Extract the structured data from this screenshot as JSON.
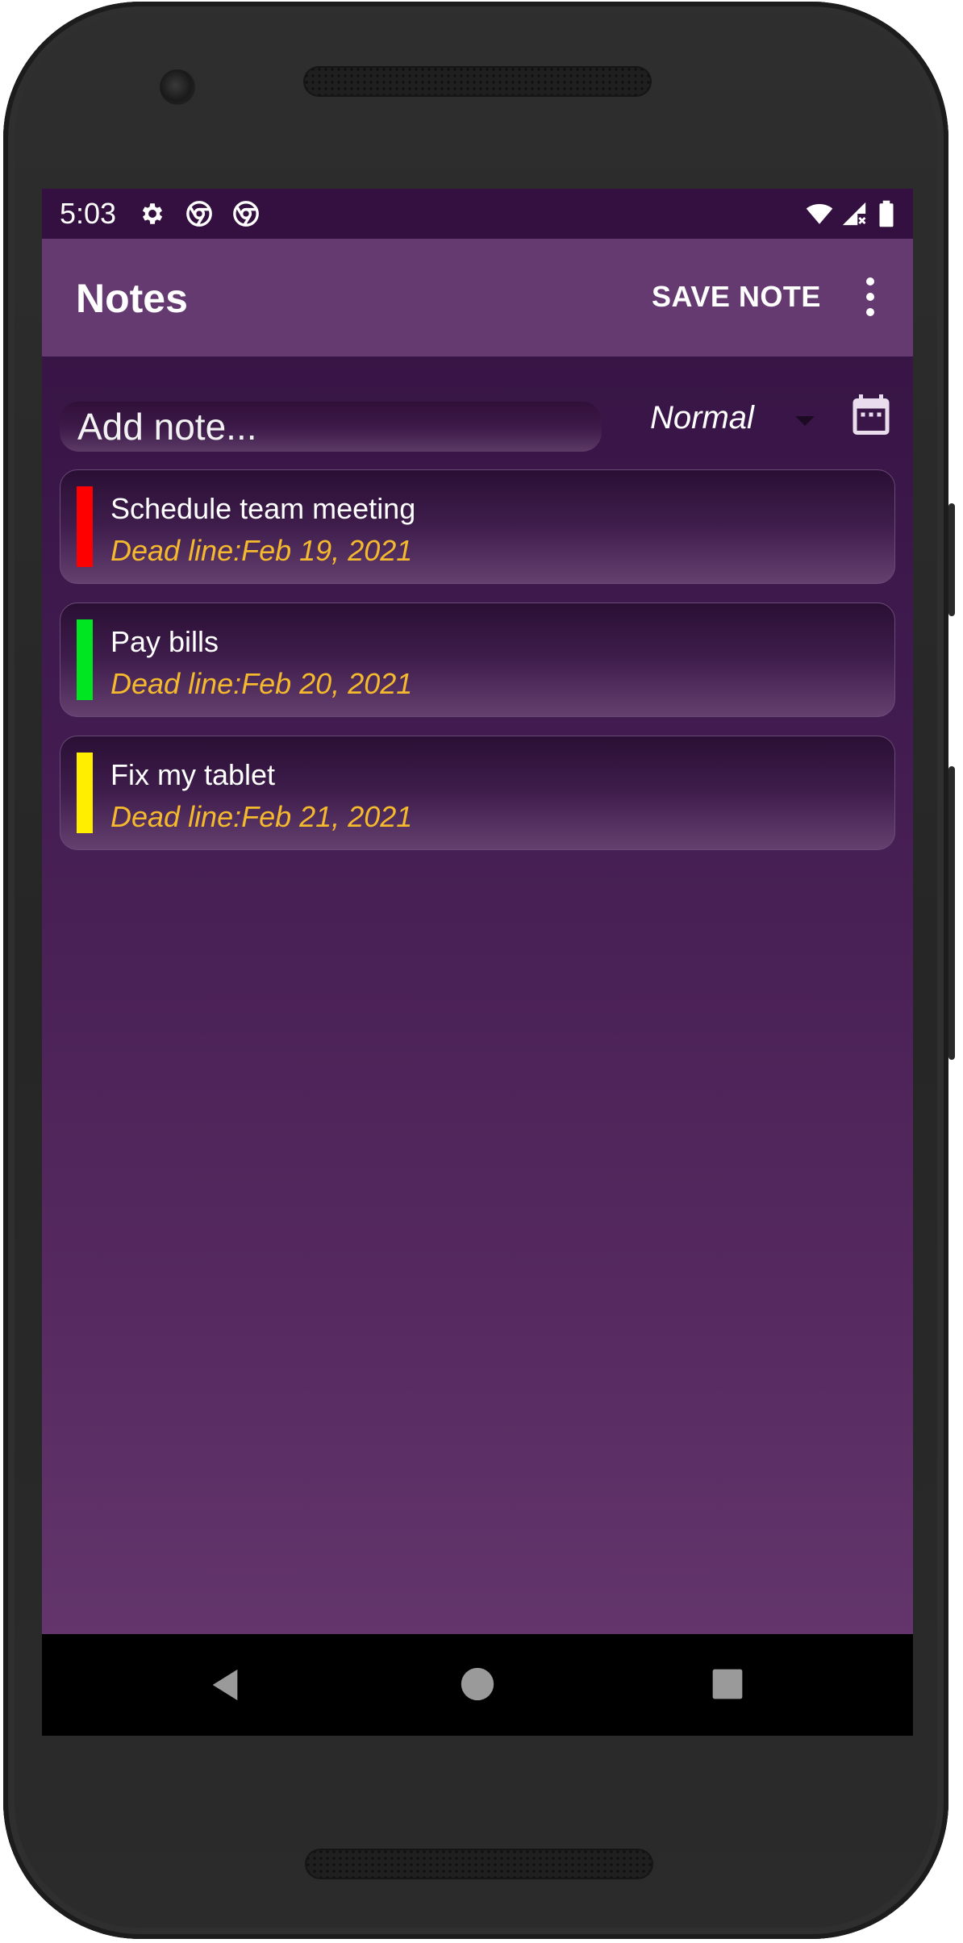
{
  "status_bar": {
    "time": "5:03"
  },
  "app_bar": {
    "title": "Notes",
    "save_label": "SAVE NOTE"
  },
  "composer": {
    "placeholder": "Add note...",
    "priority": "Normal"
  },
  "notes": [
    {
      "title": "Schedule team meeting",
      "deadline": "Dead line:Feb 19, 2021",
      "color": "#ff0000"
    },
    {
      "title": "Pay bills",
      "deadline": "Dead line:Feb 20, 2021",
      "color": "#00e620"
    },
    {
      "title": "Fix my tablet",
      "deadline": "Dead line:Feb 21, 2021",
      "color": "#ffee00"
    }
  ],
  "colors": {
    "accent_deadline": "#f5b92e",
    "appbar": "#643a70",
    "statusbar": "#33103f"
  },
  "icons": {
    "status": [
      "gear-icon",
      "chrome-icon",
      "chrome-icon",
      "wifi-icon",
      "signal-icon",
      "battery-icon"
    ],
    "nav": [
      "back-icon",
      "home-icon",
      "recents-icon"
    ]
  }
}
